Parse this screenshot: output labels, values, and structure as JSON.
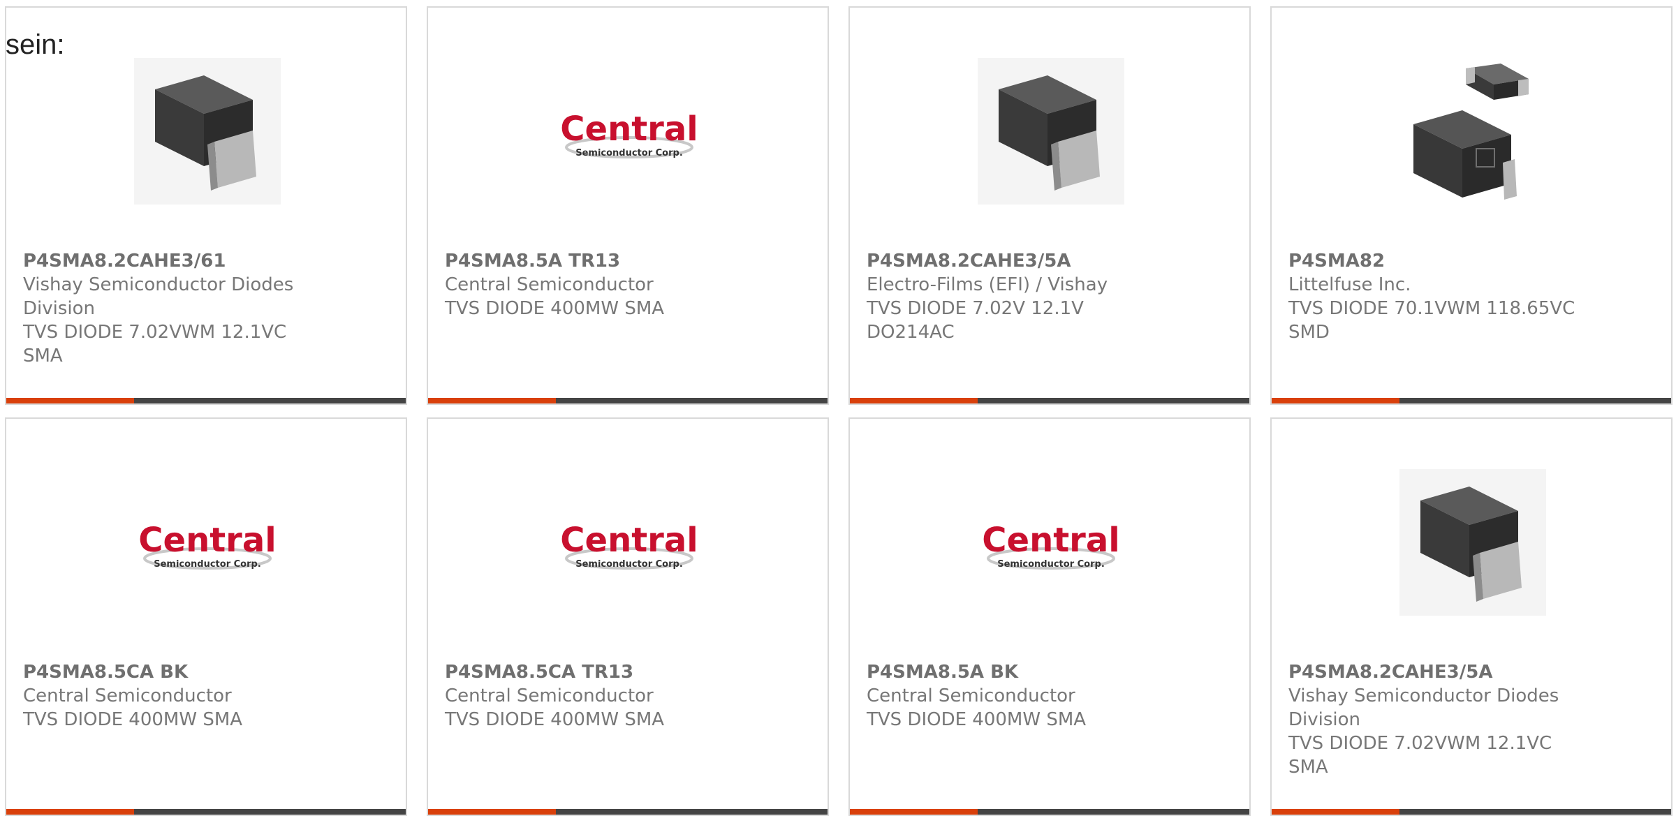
{
  "lead_text": "sein:",
  "colors": {
    "accent": "#d9400b",
    "bar_dark": "#444444",
    "border": "#d9d9d9",
    "text": "#777777",
    "central_red": "#c8102e"
  },
  "cards": [
    {
      "part_number": "P4SMA8.2CAHE3/61",
      "manufacturer": "Vishay Semiconductor Diodes Division",
      "description": "TVS DIODE 7.02VWM 12.1VC SMA",
      "image": "sma-package-photo"
    },
    {
      "part_number": "P4SMA8.5A TR13",
      "manufacturer": "Central Semiconductor",
      "description": "TVS DIODE 400MW SMA",
      "image": "central-logo",
      "logo_main": "Central",
      "logo_sub": "Semiconductor Corp."
    },
    {
      "part_number": "P4SMA8.2CAHE3/5A",
      "manufacturer": "Electro-Films (EFI) / Vishay",
      "description": "TVS DIODE 7.02V 12.1V DO214AC",
      "image": "sma-package-photo"
    },
    {
      "part_number": "P4SMA82",
      "manufacturer": "Littelfuse Inc.",
      "description": "TVS DIODE 70.1VWM 118.65VC SMD",
      "image": "smd-two-packages-photo"
    },
    {
      "part_number": "P4SMA8.5CA BK",
      "manufacturer": "Central Semiconductor",
      "description": "TVS DIODE 400MW SMA",
      "image": "central-logo",
      "logo_main": "Central",
      "logo_sub": "Semiconductor Corp."
    },
    {
      "part_number": "P4SMA8.5CA TR13",
      "manufacturer": "Central Semiconductor",
      "description": "TVS DIODE 400MW SMA",
      "image": "central-logo",
      "logo_main": "Central",
      "logo_sub": "Semiconductor Corp."
    },
    {
      "part_number": "P4SMA8.5A BK",
      "manufacturer": "Central Semiconductor",
      "description": "TVS DIODE 400MW SMA",
      "image": "central-logo",
      "logo_main": "Central",
      "logo_sub": "Semiconductor Corp."
    },
    {
      "part_number": "P4SMA8.2CAHE3/5A",
      "manufacturer": "Vishay Semiconductor Diodes Division",
      "description": "TVS DIODE 7.02VWM 12.1VC SMA",
      "image": "sma-package-photo"
    }
  ]
}
